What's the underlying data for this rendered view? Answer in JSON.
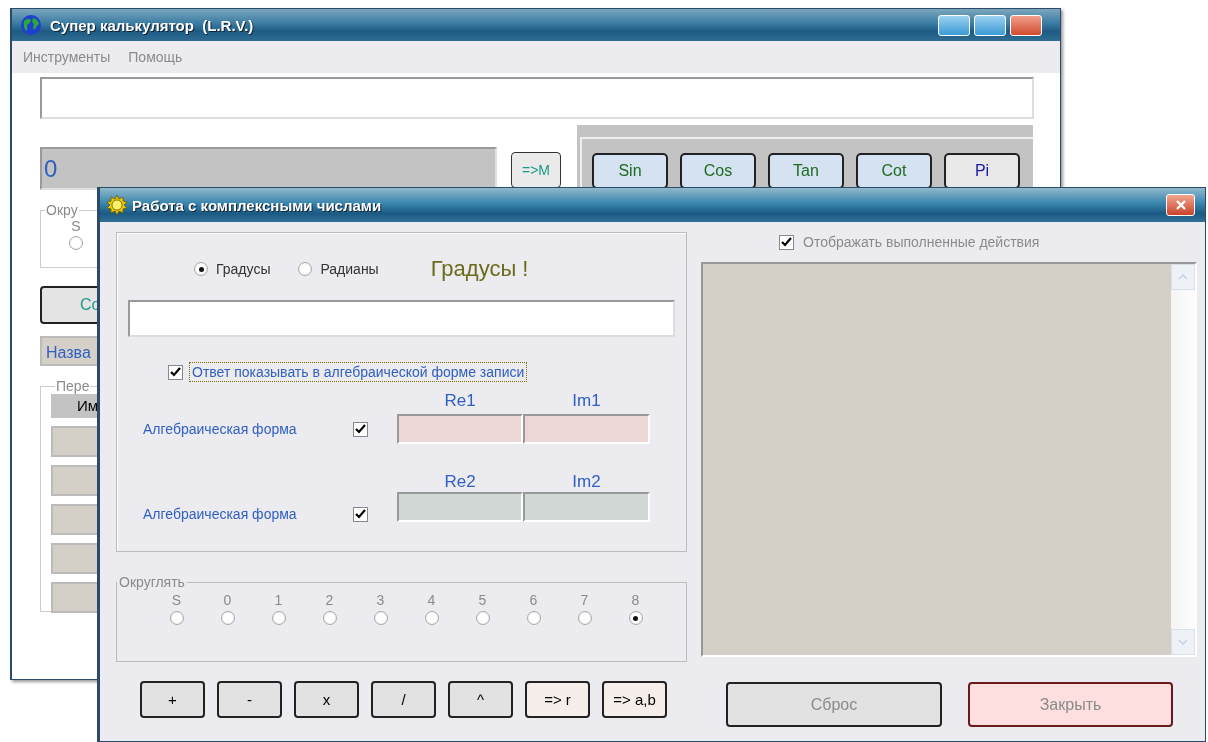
{
  "main_window": {
    "title": "Супер калькулятор  (L.R.V.)",
    "menu": [
      "Инструменты",
      "Помощь"
    ],
    "display": {
      "value": "0"
    },
    "memory_button": "=>M",
    "function_buttons": [
      {
        "label": "Sin",
        "kind": "trig"
      },
      {
        "label": "Cos",
        "kind": "trig"
      },
      {
        "label": "Tan",
        "kind": "trig"
      },
      {
        "label": "Cot",
        "kind": "trig"
      },
      {
        "label": "Pi",
        "kind": "constant"
      }
    ],
    "rounding_group": {
      "label": "Окру",
      "options": [
        {
          "label": "S",
          "selected": false
        }
      ]
    },
    "button_1": "Со",
    "name_field": {
      "value": "Назва"
    },
    "group_2": {
      "label": "Пере",
      "columns": [
        "Им"
      ],
      "rows": [
        {
          "kind": "empty"
        },
        {
          "kind": "empty"
        },
        {
          "kind": "empty"
        },
        {
          "kind": "empty"
        },
        {
          "kind": "empty"
        }
      ]
    }
  },
  "dialog": {
    "title": "Работа с комплексными числами",
    "angle_units": [
      {
        "label": "Градусы",
        "selected": true
      },
      {
        "label": "Радианы",
        "selected": false
      }
    ],
    "angle_status": "Градусы !",
    "algebraic_answer": {
      "label": "Ответ показывать в алгебраической форме записи",
      "checked": true
    },
    "operands": [
      {
        "label": "Алгебраическая форма",
        "checked": true,
        "re_label": "Re1",
        "im_label": "Im1",
        "color": "#ecd6d6"
      },
      {
        "label": "Алгебраическая форма",
        "checked": true,
        "re_label": "Re2",
        "im_label": "Im2",
        "color": "#d2d8d6"
      }
    ],
    "rounding": {
      "label": "Округлять",
      "options": [
        {
          "label": "S",
          "selected": false
        },
        {
          "label": "0",
          "selected": false
        },
        {
          "label": "1",
          "selected": false
        },
        {
          "label": "2",
          "selected": false
        },
        {
          "label": "3",
          "selected": false
        },
        {
          "label": "4",
          "selected": false
        },
        {
          "label": "5",
          "selected": false
        },
        {
          "label": "6",
          "selected": false
        },
        {
          "label": "7",
          "selected": false
        },
        {
          "label": "8",
          "selected": true
        }
      ]
    },
    "operations": [
      {
        "label": "+",
        "kind": "arithmetic"
      },
      {
        "label": "-",
        "kind": "arithmetic"
      },
      {
        "label": "x",
        "kind": "arithmetic"
      },
      {
        "label": "/",
        "kind": "arithmetic"
      },
      {
        "label": "^",
        "kind": "arithmetic"
      },
      {
        "label": "=> r",
        "kind": "convert"
      },
      {
        "label": "=> a,b",
        "kind": "convert"
      }
    ],
    "show_steps": {
      "label": "Отображать выполненные действия",
      "checked": true
    },
    "buttons": [
      {
        "label": "Сброс",
        "kind": "reset"
      },
      {
        "label": "Закрыть",
        "kind": "close"
      }
    ]
  }
}
